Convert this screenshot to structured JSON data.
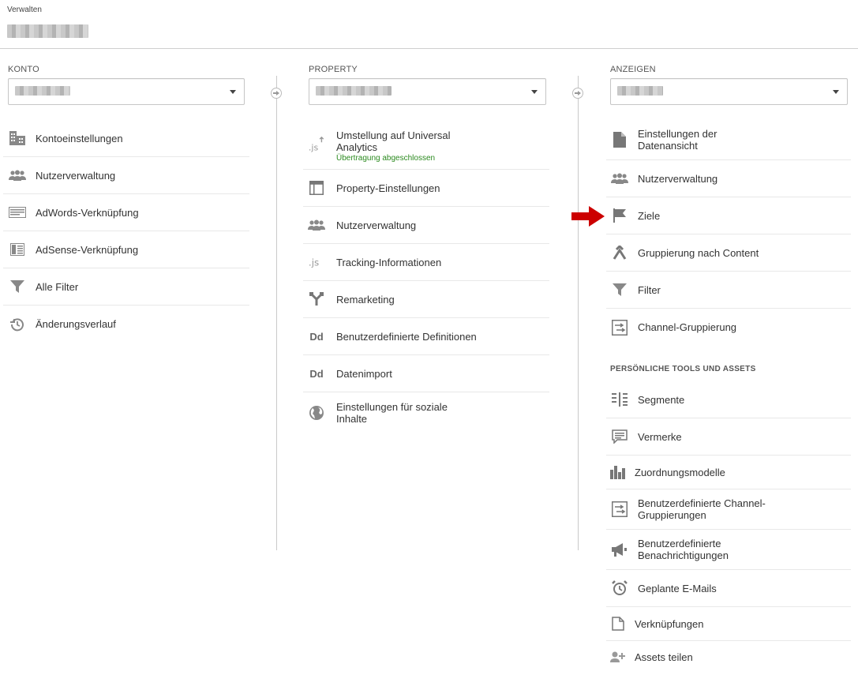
{
  "header": {
    "label": "Verwalten"
  },
  "konto": {
    "title": "KONTO",
    "items": [
      {
        "label": "Kontoeinstellungen",
        "icon": "building-icon"
      },
      {
        "label": "Nutzerverwaltung",
        "icon": "users-icon"
      },
      {
        "label": "AdWords-Verknüpfung",
        "icon": "adwords-icon"
      },
      {
        "label": "AdSense-Verknüpfung",
        "icon": "adsense-icon"
      },
      {
        "label": "Alle Filter",
        "icon": "filter-icon"
      },
      {
        "label": "Änderungsverlauf",
        "icon": "history-icon"
      }
    ]
  },
  "property": {
    "title": "PROPERTY",
    "items": [
      {
        "label": "Umstellung auf Universal Analytics",
        "sub": "Übertragung abgeschlossen",
        "icon": "js-upgrade-icon"
      },
      {
        "label": "Property-Einstellungen",
        "icon": "window-icon"
      },
      {
        "label": "Nutzerverwaltung",
        "icon": "users-icon"
      },
      {
        "label": "Tracking-Informationen",
        "icon": "js-icon"
      },
      {
        "label": "Remarketing",
        "icon": "remarketing-icon"
      },
      {
        "label": "Benutzerdefinierte Definitionen",
        "icon": "dd-icon"
      },
      {
        "label": "Datenimport",
        "icon": "dd-icon"
      },
      {
        "label": "Einstellungen für soziale Inhalte",
        "icon": "globe-icon"
      }
    ]
  },
  "anzeigen": {
    "title": "ANZEIGEN",
    "items": [
      {
        "label": "Einstellungen der Datenansicht",
        "icon": "document-icon"
      },
      {
        "label": "Nutzerverwaltung",
        "icon": "users-icon"
      },
      {
        "label": "Ziele",
        "icon": "flag-icon"
      },
      {
        "label": "Gruppierung nach Content",
        "icon": "content-grouping-icon"
      },
      {
        "label": "Filter",
        "icon": "filter-icon"
      },
      {
        "label": "Channel-Gruppierung",
        "icon": "channel-icon"
      }
    ],
    "tools_title": "PERSÖNLICHE TOOLS UND ASSETS",
    "tools": [
      {
        "label": "Segmente",
        "icon": "segments-icon"
      },
      {
        "label": "Vermerke",
        "icon": "comment-icon"
      },
      {
        "label": "Zuordnungsmodelle",
        "icon": "bar-chart-icon"
      },
      {
        "label": "Benutzerdefinierte Channel-Gruppierungen",
        "icon": "channel-icon"
      },
      {
        "label": "Benutzerdefinierte Benachrichtigungen",
        "icon": "megaphone-icon"
      },
      {
        "label": "Geplante E-Mails",
        "icon": "alarm-clock-icon"
      },
      {
        "label": "Verknüpfungen",
        "icon": "shortcut-icon"
      },
      {
        "label": "Assets teilen",
        "icon": "add-user-icon"
      }
    ]
  },
  "colors": {
    "success_text": "#2b8a1f",
    "arrow_red": "#cc0000",
    "icon_gray": "#777777"
  }
}
